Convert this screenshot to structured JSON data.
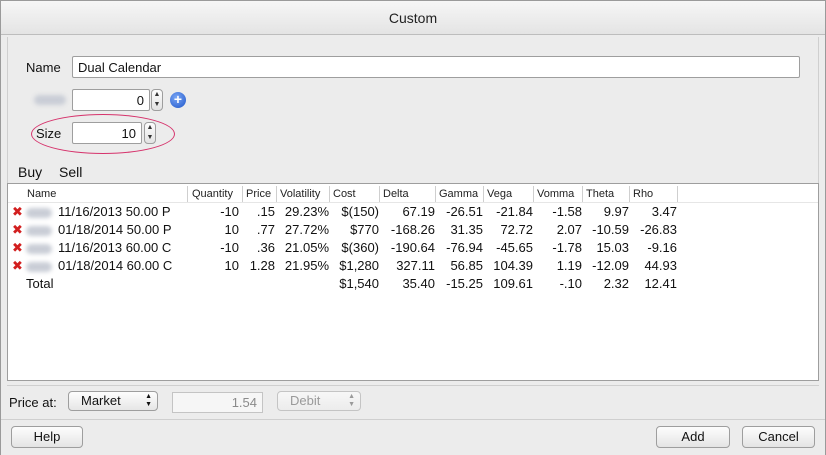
{
  "window": {
    "title": "Custom"
  },
  "form": {
    "name_label": "Name",
    "name_value": "Dual Calendar",
    "qty_value": "0",
    "size_label": "Size",
    "size_value": "10"
  },
  "tabs": [
    "Buy",
    "Sell"
  ],
  "table": {
    "columns": [
      "Name",
      "Quantity",
      "Price",
      "Volatility",
      "Cost",
      "Delta",
      "Gamma",
      "Vega",
      "Vomma",
      "Theta",
      "Rho"
    ],
    "rows": [
      [
        "11/16/2013 50.00 P",
        "-10",
        ".15",
        "29.23%",
        "$(150)",
        "67.19",
        "-26.51",
        "-21.84",
        "-1.58",
        "9.97",
        "3.47"
      ],
      [
        "01/18/2014 50.00 P",
        "10",
        ".77",
        "27.72%",
        "$770",
        "-168.26",
        "31.35",
        "72.72",
        "2.07",
        "-10.59",
        "-26.83"
      ],
      [
        "11/16/2013 60.00 C",
        "-10",
        ".36",
        "21.05%",
        "$(360)",
        "-190.64",
        "-76.94",
        "-45.65",
        "-1.78",
        "15.03",
        "-9.16"
      ],
      [
        "01/18/2014 60.00 C",
        "10",
        "1.28",
        "21.95%",
        "$1,280",
        "327.11",
        "56.85",
        "104.39",
        "1.19",
        "-12.09",
        "44.93"
      ]
    ],
    "total": [
      "Total",
      "",
      "",
      "",
      "$1,540",
      "35.40",
      "-15.25",
      "109.61",
      "-.10",
      "2.32",
      "12.41"
    ]
  },
  "price_bar": {
    "label": "Price at:",
    "mode": "Market",
    "price": "1.54",
    "side": "Debit"
  },
  "buttons": {
    "help": "Help",
    "add": "Add",
    "cancel": "Cancel"
  },
  "colors": {
    "remove_icon": "#d21f1f",
    "size_highlight": "#d6336c",
    "add_icon": "#1f56c9"
  }
}
